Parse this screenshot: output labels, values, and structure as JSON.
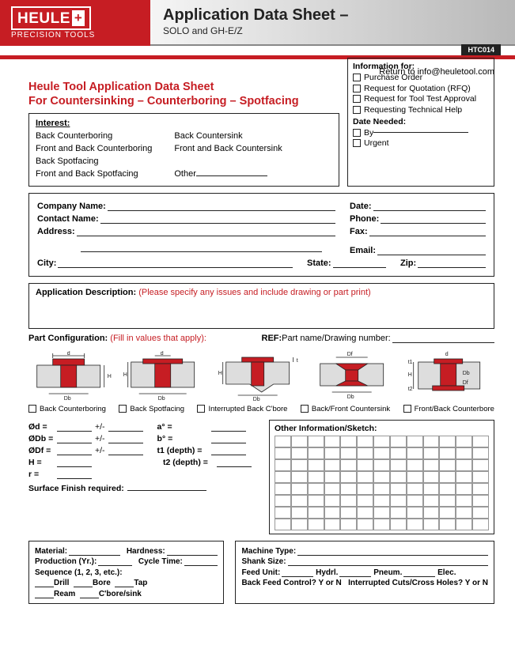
{
  "header": {
    "logo_main": "HEULE",
    "logo_plus": "+",
    "logo_sub": "PRECISION TOOLS",
    "title": "Application Data Sheet",
    "title_dash": " –",
    "subtitle": "SOLO and GH-E/Z",
    "code": "HTC014"
  },
  "return_to": "Return to info@heuletool.com",
  "sheet_title_l1": "Heule Tool Application Data Sheet",
  "sheet_title_l2": "For Countersinking – Counterboring – Spotfacing",
  "interest": {
    "header": "Interest:",
    "col1": [
      "Back Counterboring",
      "Front and Back Counterboring",
      "Back Spotfacing",
      "Front and Back Spotfacing"
    ],
    "col2": [
      "Back Countersink",
      "Front and Back Countersink",
      "",
      "Other"
    ]
  },
  "info_box": {
    "header": "Information for:",
    "items": [
      "Purchase Order",
      "Request for Quotation (RFQ)",
      "Request for Tool Test Approval",
      "Requesting Technical Help"
    ],
    "date_needed": "Date Needed:",
    "by": "By",
    "urgent": "Urgent"
  },
  "contact": {
    "company": "Company Name:",
    "contact_name": "Contact Name:",
    "address": "Address:",
    "city": "City:",
    "state": "State:",
    "zip": "Zip:",
    "date": "Date:",
    "phone": "Phone:",
    "fax": "Fax:",
    "email": "Email:"
  },
  "app_desc": {
    "label": "Application Description:",
    "hint": "(Please specify any issues and include drawing or part print)"
  },
  "part_config": {
    "label": "Part Configuration:",
    "hint": "(Fill in values that apply):",
    "ref_label": "REF:",
    "ref_text": " Part name/Drawing number:"
  },
  "config_checks": [
    "Back Counterboring",
    "Back Spotfacing",
    "Interrupted Back C'bore",
    "Back/Front Countersink",
    "Front/Back Counterbore"
  ],
  "dims": {
    "od": "Ød =",
    "odb": "ØDb =",
    "odf": "ØDf =",
    "h": "H =",
    "r": "r =",
    "a": "a° =",
    "b": "b° =",
    "t1": "t1 (depth) =",
    "t2": "t2 (depth) =",
    "pm": "+/-",
    "sfr": "Surface Finish required:"
  },
  "sketch_header": "Other Information/Sketch:",
  "material_box": {
    "material": "Material:",
    "hardness": "Hardness:",
    "production": "Production (Yr.):",
    "cycle": "Cycle Time:",
    "sequence": "Sequence (1, 2, 3, etc.):",
    "drill": "Drill",
    "bore": "Bore",
    "tap": "Tap",
    "ream": "Ream",
    "cbore": "C'bore/sink"
  },
  "machine_box": {
    "machine": "Machine Type:",
    "shank": "Shank Size:",
    "feed": "Feed Unit:",
    "hydrl": "Hydrl.",
    "pneum": "Pneum.",
    "elec": "Elec.",
    "back_feed": "Back Feed Control? Y or N",
    "interrupted": "Interrupted Cuts/Cross Holes? Y or N"
  },
  "dia_labels": {
    "d": "d",
    "Db": "Db",
    "Df": "Df",
    "H": "H",
    "t": "t",
    "t1": "t1",
    "t2": "t2"
  }
}
